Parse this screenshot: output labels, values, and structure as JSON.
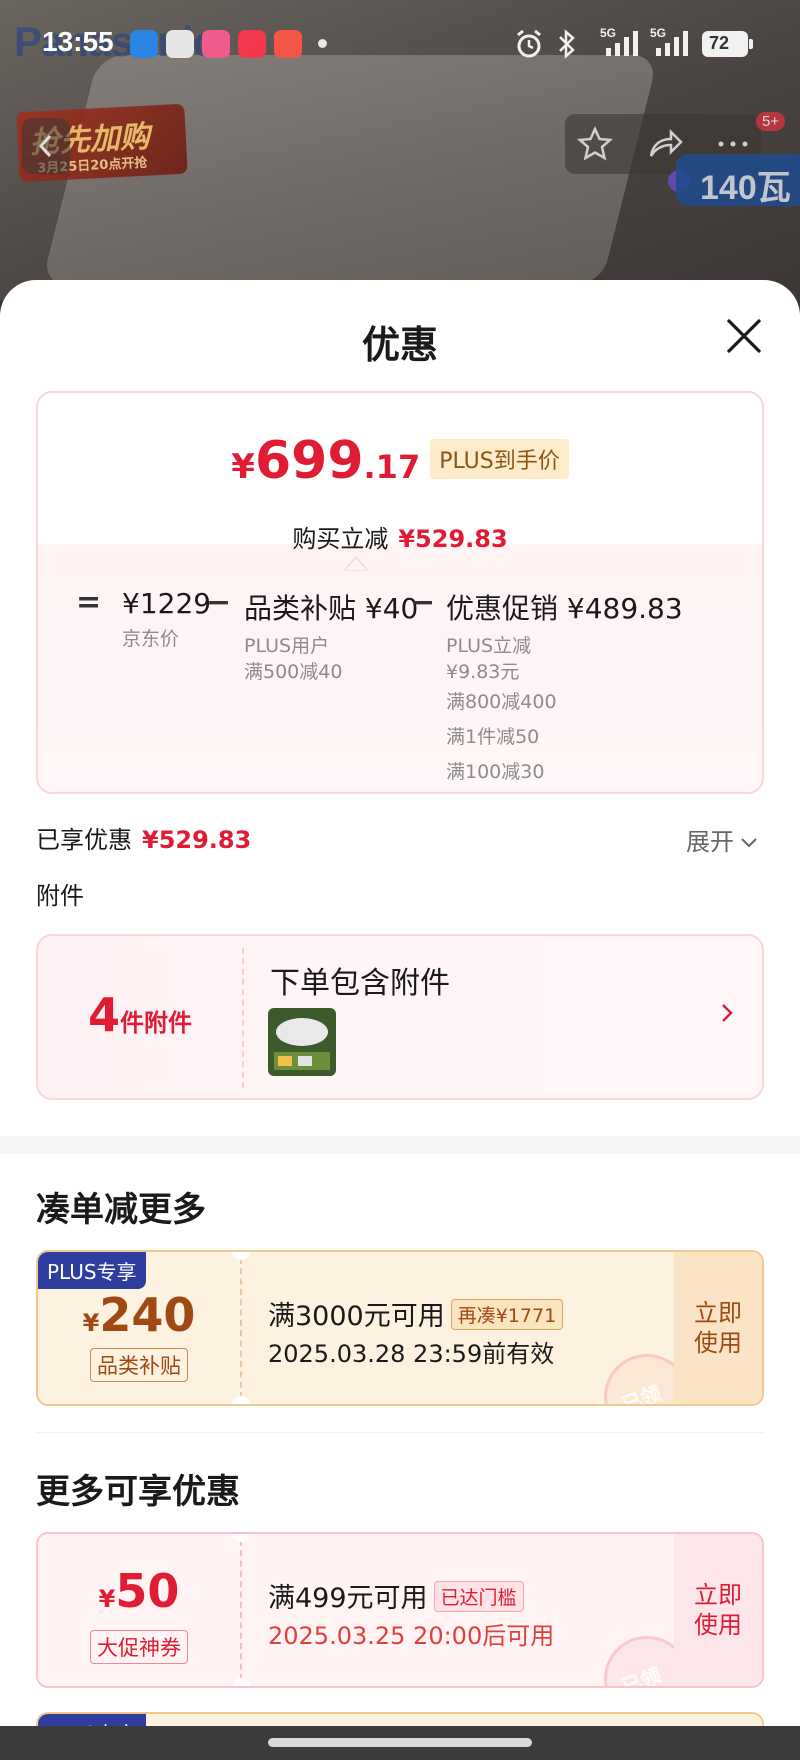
{
  "status_bar": {
    "time": "13:55",
    "battery": "72",
    "network_1": "5G",
    "network_2": "5G"
  },
  "background": {
    "brand": "Panasonic",
    "promo_title": "抢先加购",
    "promo_sub": "3月25日20点开抢",
    "cart_count": "5+",
    "watt_label": "140瓦"
  },
  "sheet": {
    "title": "优惠"
  },
  "price_card": {
    "currency": "¥",
    "price_int": "699",
    "price_dec": ".17",
    "plus_tag": "PLUS到手价",
    "discount_label": "购买立减",
    "discount_amount": "¥529.83",
    "eq_symbol": "=",
    "minus_symbol": "−",
    "jd_price": "¥1229",
    "jd_price_label": "京东价",
    "subsidy_main": "品类补贴 ¥40",
    "subsidy_sub_1": "PLUS用户",
    "subsidy_sub_2": "满500减40",
    "promo_main": "优惠促销 ¥489.83",
    "promo_sub_1": "PLUS立减",
    "promo_sub_2": "¥9.83元",
    "promo_sub_3": "满800减400",
    "promo_sub_4": "满1件减50",
    "promo_sub_5": "满100减30"
  },
  "summary": {
    "enjoyed_label": "已享优惠",
    "enjoyed_amount": "¥529.83",
    "expand_label": "展开"
  },
  "accessories": {
    "title": "附件",
    "count_num": "4",
    "count_unit": "件附件",
    "label": "下单包含附件"
  },
  "section_more": {
    "title": "凑单减更多"
  },
  "coupon_1": {
    "plus_badge": "PLUS专享",
    "currency": "¥",
    "amount": "240",
    "type": "品类补贴",
    "condition": "满3000元可用",
    "tag": "再凑¥1771",
    "date": "2025.03.28 23:59前有效",
    "use_label_1": "立即",
    "use_label_2": "使用",
    "stamp": "已领"
  },
  "section_extra": {
    "title": "更多可享优惠"
  },
  "coupon_2": {
    "currency": "¥",
    "amount": "50",
    "type": "大促神券",
    "condition": "满499元可用",
    "tag": "已达门槛",
    "date": "2025.03.25 20:00后可用",
    "use_label_1": "立即",
    "use_label_2": "使用",
    "stamp": "已领"
  },
  "coupon_3_peek": {
    "plus_badge": "PLUS专享"
  },
  "colors": {
    "accent_red": "#e01c34",
    "plus_gold_bg": "#fdebc9",
    "plus_badge_blue": "#2e3e9e",
    "coupon_gold": "#9e4a12"
  }
}
